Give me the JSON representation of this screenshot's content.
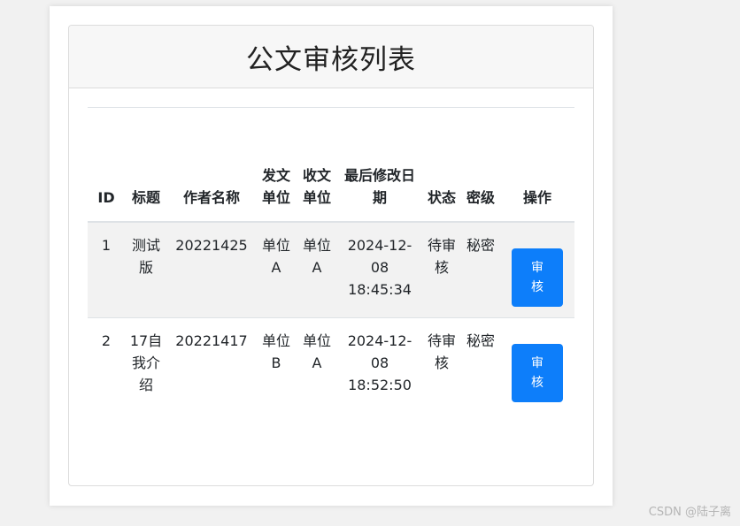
{
  "page": {
    "title": "公文审核列表"
  },
  "table": {
    "headers": [
      "ID",
      "标题",
      "作者名称",
      "发文单位",
      "收文单位",
      "最后修改日期",
      "状态",
      "密级",
      "操作"
    ],
    "rows": [
      {
        "id": "1",
        "title": "测试版",
        "author": "20221425",
        "sender": "单位A",
        "receiver": "单位A",
        "modified": "2024-12-08 18:45:34",
        "status": "待审核",
        "secret": "秘密",
        "action": "审核"
      },
      {
        "id": "2",
        "title": "17自我介绍",
        "author": "20221417",
        "sender": "单位B",
        "receiver": "单位A",
        "modified": "2024-12-08 18:52:50",
        "status": "待审核",
        "secret": "秘密",
        "action": "审核"
      }
    ]
  },
  "watermark": "CSDN @陆子离",
  "colors": {
    "button": "#0d7efa",
    "stripe": "#f2f2f2"
  }
}
